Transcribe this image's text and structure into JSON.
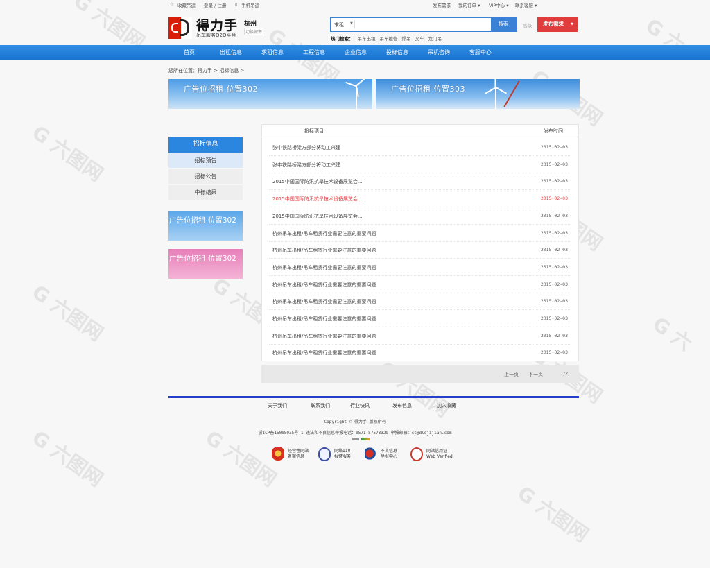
{
  "topbar": {
    "favorite": "收藏吊运",
    "login": "登录 / 注册",
    "mobile": "手机吊运",
    "publish_demand": "发布需求",
    "my_orders": "我的订单",
    "vip": "VIP中心",
    "contact": "联系客服"
  },
  "header": {
    "logo_title": "得力手",
    "logo_sub": "吊车服务O2O平台",
    "city": "杭州",
    "city_switch": "切换城市",
    "search": {
      "category": "求租",
      "placeholder": "",
      "button": "搜索",
      "hot_label": "热门搜索：",
      "hot_items": [
        "吊车出租",
        "吊车维修",
        "焊吊",
        "叉车",
        "龙门吊"
      ]
    },
    "advanced": "高级",
    "publish_button": "发布需求"
  },
  "nav": [
    "首页",
    "出租信息",
    "求租信息",
    "工程信息",
    "企业信息",
    "投标信息",
    "吊机咨询",
    "客服中心"
  ],
  "breadcrumb": "您所在位置：得力手 > 招标信息 >",
  "banners": [
    "广告位招租 位置302",
    "广告位招租 位置303"
  ],
  "sidebar": {
    "title": "招标信息",
    "items": [
      "招标预告",
      "招标公告",
      "中标结果"
    ],
    "ads": [
      "广告位招租 位置302",
      "广告位招租 位置302"
    ]
  },
  "list": {
    "col_project": "投标项目",
    "col_date": "发布时间",
    "rows": [
      {
        "title": "张中铁路桥梁方部分将动工兴建",
        "date": "2015-02-03"
      },
      {
        "title": "张中铁路桥梁方部分将动工兴建",
        "date": "2015-02-03"
      },
      {
        "title": "2015中国国际防汛抗旱技术设备展览会....",
        "date": "2015-02-03"
      },
      {
        "title": "2015中国国际防汛抗旱技术设备展览会....",
        "date": "2015-02-03"
      },
      {
        "title": "2015中国国际防汛抗旱技术设备展览会....",
        "date": "2015-02-03"
      },
      {
        "title": "杭州吊车出租/吊车租赁行业需要注意的重要问题",
        "date": "2015-02-03"
      },
      {
        "title": "杭州吊车出租/吊车租赁行业需要注意的重要问题",
        "date": "2015-02-03"
      },
      {
        "title": "杭州吊车出租/吊车租赁行业需要注意的重要问题",
        "date": "2015-02-03"
      },
      {
        "title": "杭州吊车出租/吊车租赁行业需要注意的重要问题",
        "date": "2015-02-03"
      },
      {
        "title": "杭州吊车出租/吊车租赁行业需要注意的重要问题",
        "date": "2015-02-03"
      },
      {
        "title": "杭州吊车出租/吊车租赁行业需要注意的重要问题",
        "date": "2015-02-03"
      },
      {
        "title": "杭州吊车出租/吊车租赁行业需要注意的重要问题",
        "date": "2015-02-03"
      },
      {
        "title": "杭州吊车出租/吊车租赁行业需要注意的重要问题",
        "date": "2015-02-03"
      }
    ],
    "highlight_color": "#e13c3c"
  },
  "pager": {
    "prev": "上一页",
    "next": "下一页",
    "page": "1/2"
  },
  "footer": {
    "links": [
      "关于我们",
      "联系我们",
      "行业快讯",
      "发布信息",
      "加入收藏"
    ],
    "copyright": "Copyright © 得力手 版权所有",
    "icp": "浙ICP备15008035号-1 违法和不良信息举报电话：0571-57573329 举报邮箱：cc@dlsjijian.com",
    "badges": [
      {
        "icon": "police-badge-icon",
        "l1": "经营性网站",
        "l2": "备案信息"
      },
      {
        "icon": "shield-icon",
        "l1": "网络110",
        "l2": "报警服务"
      },
      {
        "icon": "report-center-icon",
        "l1": "不良信息",
        "l2": "举报中心"
      },
      {
        "icon": "seal-icon",
        "l1": "网站信用证",
        "l2": "Web Verified"
      }
    ]
  },
  "colors": {
    "nav": "#1a73d1",
    "accent": "#2b86e0",
    "publish": "#e13c3c",
    "footer_line": "#2740c9"
  }
}
